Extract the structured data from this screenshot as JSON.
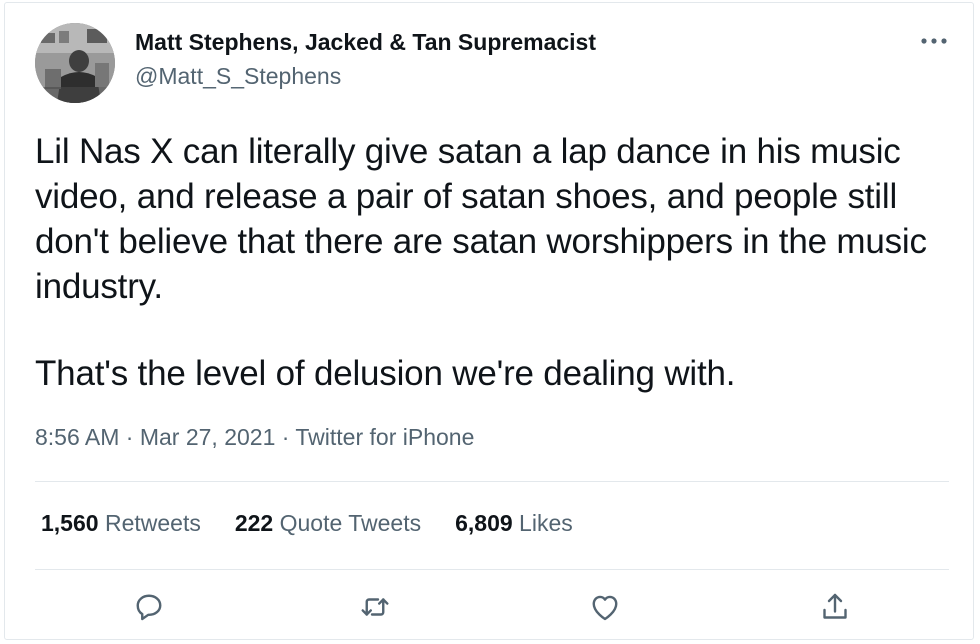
{
  "tweet": {
    "author": {
      "name": "Matt Stephens, Jacked & Tan Supremacist",
      "handle": "@Matt_S_Stephens"
    },
    "text": {
      "paragraph_1": "Lil Nas X can literally give satan a lap dance in his music video, and release a pair of satan shoes, and people still don't believe that there are satan worshippers in the music industry.",
      "paragraph_2": "That's the level of delusion we're dealing with."
    },
    "meta": {
      "time": "8:56 AM",
      "sep1": " · ",
      "date": "Mar 27, 2021",
      "sep2": " · ",
      "source": "Twitter for iPhone"
    },
    "stats": {
      "retweets_count": "1,560",
      "retweets_label": "Retweets",
      "quotes_count": "222",
      "quotes_label": "Quote Tweets",
      "likes_count": "6,809",
      "likes_label": "Likes"
    }
  },
  "icons": {
    "more": "more-horizontal-icon",
    "reply": "reply-icon",
    "retweet": "retweet-icon",
    "like": "heart-icon",
    "share": "share-icon"
  },
  "colors": {
    "text_primary": "#0f1419",
    "text_secondary": "#536471",
    "divider": "#e3e8ec",
    "icon": "#536471"
  }
}
